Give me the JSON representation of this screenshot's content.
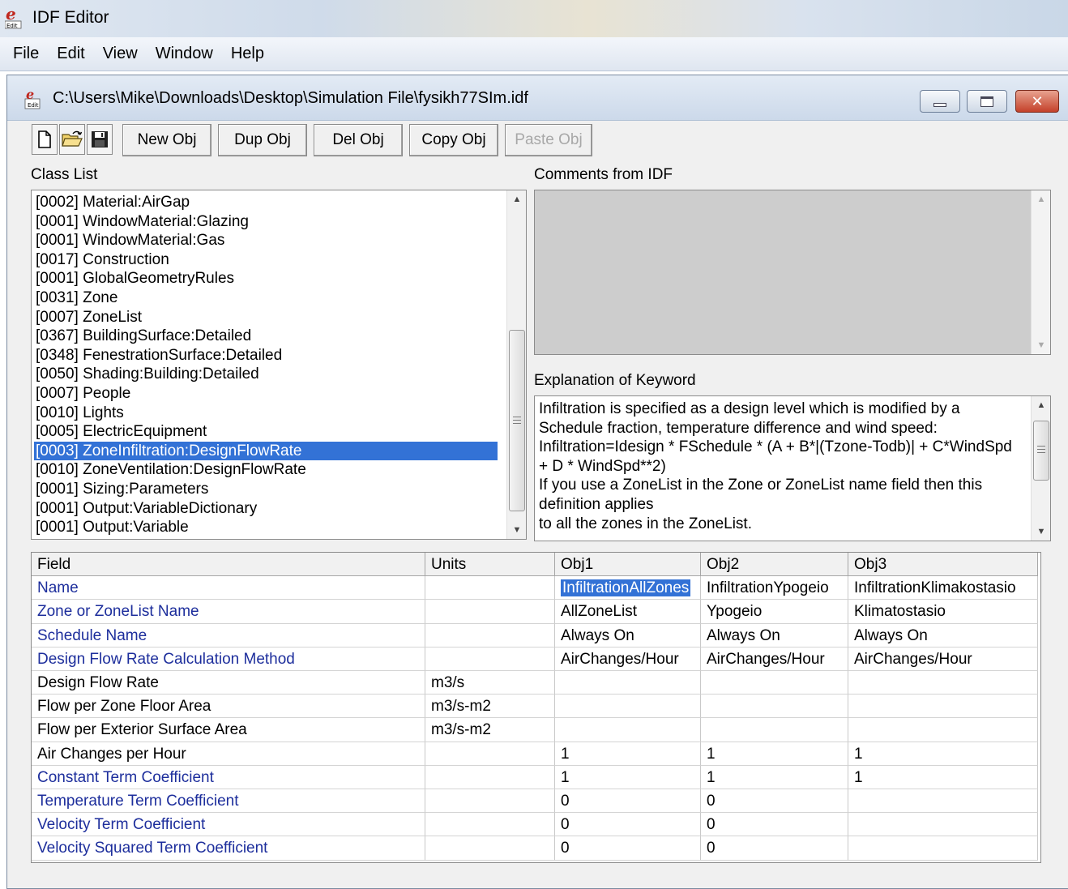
{
  "app": {
    "title": "IDF Editor",
    "menu": [
      "File",
      "Edit",
      "View",
      "Window",
      "Help"
    ]
  },
  "window": {
    "title": "C:\\Users\\Mike\\Downloads\\Desktop\\Simulation File\\fysikh77SIm.idf"
  },
  "toolbar": {
    "new_obj": "New Obj",
    "dup_obj": "Dup Obj",
    "del_obj": "Del Obj",
    "copy_obj": "Copy Obj",
    "paste_obj": "Paste Obj"
  },
  "labels": {
    "class_list": "Class List",
    "comments": "Comments from IDF",
    "explanation": "Explanation of Keyword"
  },
  "class_list": [
    "[0002]  Material:AirGap",
    "[0001]  WindowMaterial:Glazing",
    "[0001]  WindowMaterial:Gas",
    "[0017]  Construction",
    "[0001]  GlobalGeometryRules",
    "[0031]  Zone",
    "[0007]  ZoneList",
    "[0367]  BuildingSurface:Detailed",
    "[0348]  FenestrationSurface:Detailed",
    "[0050]  Shading:Building:Detailed",
    "[0007]  People",
    "[0010]  Lights",
    "[0005]  ElectricEquipment",
    "[0003]  ZoneInfiltration:DesignFlowRate",
    "[0010]  ZoneVentilation:DesignFlowRate",
    "[0001]  Sizing:Parameters",
    "[0001]  Output:VariableDictionary",
    "[0001]  Output:Variable"
  ],
  "explanation_lines": [
    "Infiltration is specified as a design level which is modified by a",
    "Schedule fraction, temperature difference and wind speed:",
    "Infiltration=Idesign * FSchedule * (A + B*|(Tzone-Todb)| + C*WindSpd",
    "+ D * WindSpd**2)",
    "If you use a ZoneList in the Zone or ZoneList name field then this",
    "definition applies",
    "to all the zones in the ZoneList."
  ],
  "grid": {
    "headers": [
      "Field",
      "Units",
      "Obj1",
      "Obj2",
      "Obj3"
    ],
    "rows": [
      [
        "Name",
        "",
        "InfiltrationAllZones",
        "InfiltrationYpogeio",
        "InfiltrationKlimakostasio"
      ],
      [
        "Zone or ZoneList Name",
        "",
        "AllZoneList",
        "Ypogeio",
        "Klimatostasio"
      ],
      [
        "Schedule Name",
        "",
        "Always On",
        "Always On",
        "Always On"
      ],
      [
        "Design Flow Rate Calculation Method",
        "",
        "AirChanges/Hour",
        "AirChanges/Hour",
        "AirChanges/Hour"
      ],
      [
        "Design Flow Rate",
        "m3/s",
        "",
        "",
        ""
      ],
      [
        "Flow per Zone Floor Area",
        "m3/s-m2",
        "",
        "",
        ""
      ],
      [
        "Flow per Exterior Surface Area",
        "m3/s-m2",
        "",
        "",
        ""
      ],
      [
        "Air Changes per Hour",
        "",
        "1",
        "1",
        "1"
      ],
      [
        "Constant Term Coefficient",
        "",
        "1",
        "1",
        "1"
      ],
      [
        "Temperature Term Coefficient",
        "",
        "0",
        "0",
        ""
      ],
      [
        "Velocity Term Coefficient",
        "",
        "0",
        "0",
        ""
      ],
      [
        "Velocity Squared Term Coefficient",
        "",
        "0",
        "0",
        ""
      ]
    ],
    "blue_fields": [
      0,
      1,
      2,
      3,
      8,
      9,
      10,
      11
    ]
  },
  "icons": [
    "app-logo-icon",
    "file-icon",
    "new-document-icon",
    "open-folder-icon",
    "save-disk-icon",
    "minimize-icon",
    "maximize-icon",
    "close-icon"
  ],
  "colors": {
    "selection": "#3372d6",
    "field_blue": "#1d2e9c",
    "comments_bg": "#cdcdcd"
  }
}
